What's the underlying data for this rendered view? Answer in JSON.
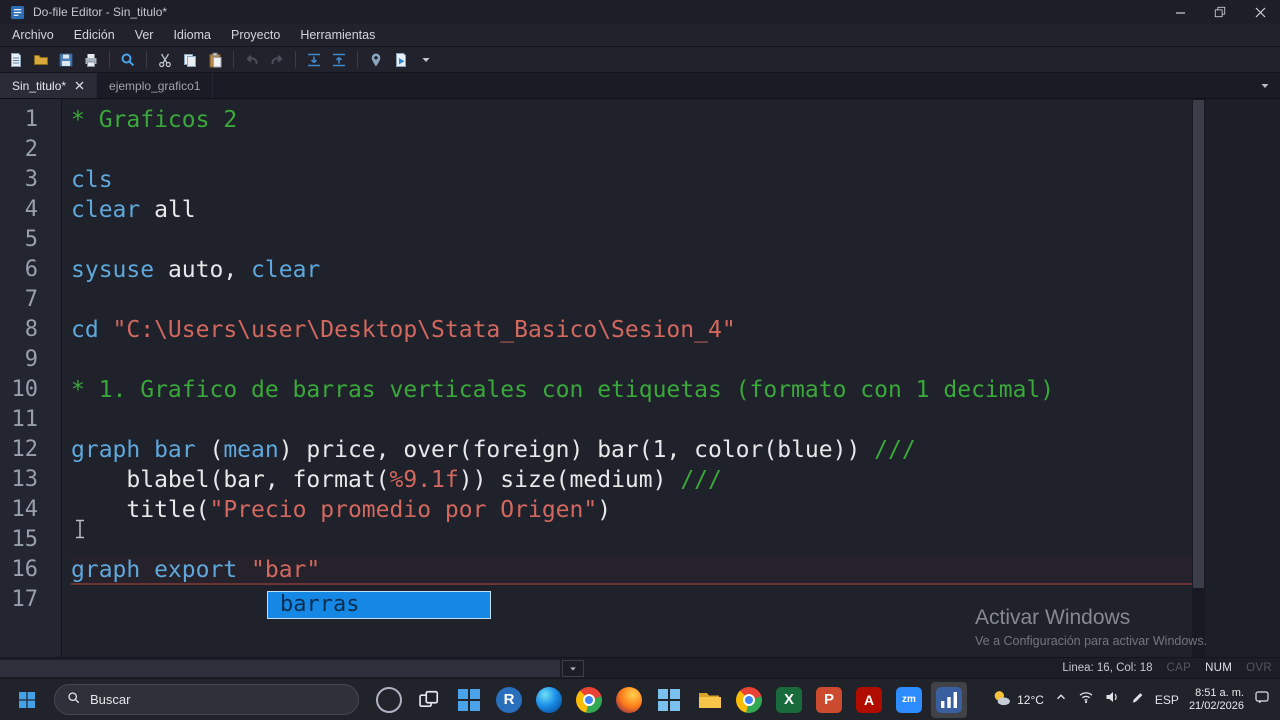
{
  "titlebar": {
    "title": "Do-file Editor - Sin_titulo*"
  },
  "menubar": {
    "items": [
      "Archivo",
      "Edición",
      "Ver",
      "Idioma",
      "Proyecto",
      "Herramientas"
    ]
  },
  "toolbar": {
    "buttons": [
      "new-do-file",
      "open-file",
      "save-file",
      "print",
      "find",
      "cut",
      "copy",
      "paste",
      "undo",
      "redo",
      "jump-next-line",
      "jump-prev-line",
      "set-marker",
      "execute-do",
      "execute-options"
    ]
  },
  "tabbar": {
    "tabs": [
      {
        "label": "Sin_titulo*",
        "active": true
      },
      {
        "label": "ejemplo_grafico1",
        "active": false
      }
    ]
  },
  "editor": {
    "current_line": 16,
    "lines": [
      {
        "n": "1",
        "segs": [
          [
            "* Graficos 2",
            "comment"
          ]
        ]
      },
      {
        "n": "2",
        "segs": []
      },
      {
        "n": "3",
        "segs": [
          [
            "cls",
            "cmd"
          ]
        ]
      },
      {
        "n": "4",
        "segs": [
          [
            "clear",
            "cmd"
          ],
          [
            " all",
            "plain"
          ]
        ]
      },
      {
        "n": "5",
        "segs": []
      },
      {
        "n": "6",
        "segs": [
          [
            "sysuse",
            "cmd"
          ],
          [
            " auto, ",
            "plain"
          ],
          [
            "clear",
            "cmd"
          ]
        ]
      },
      {
        "n": "7",
        "segs": []
      },
      {
        "n": "8",
        "segs": [
          [
            "cd ",
            "cmd"
          ],
          [
            "\"C:\\Users\\user\\Desktop\\Stata_Basico\\Sesion_4\"",
            "string"
          ]
        ]
      },
      {
        "n": "9",
        "segs": []
      },
      {
        "n": "10",
        "segs": [
          [
            "* 1. Grafico de barras verticales con etiquetas (formato con 1 decimal)",
            "comment"
          ]
        ]
      },
      {
        "n": "11",
        "segs": []
      },
      {
        "n": "12",
        "segs": [
          [
            "graph bar",
            "cmd"
          ],
          [
            " (",
            "plain"
          ],
          [
            "mean",
            "cmd"
          ],
          [
            ") price, over(foreign) bar(1, color(blue)) ",
            "plain"
          ],
          [
            "///",
            "comment"
          ]
        ]
      },
      {
        "n": "13",
        "segs": [
          [
            "    blabel(bar, format(",
            "plain"
          ],
          [
            "%9.1f",
            "string"
          ],
          [
            ")) size(medium) ",
            "plain"
          ],
          [
            "///",
            "comment"
          ]
        ]
      },
      {
        "n": "14",
        "segs": [
          [
            "    title(",
            "plain"
          ],
          [
            "\"Precio promedio por Origen\"",
            "string"
          ],
          [
            ")",
            "plain"
          ]
        ]
      },
      {
        "n": "15",
        "segs": []
      },
      {
        "n": "16",
        "segs": [
          [
            "graph export ",
            "cmd"
          ],
          [
            "\"bar\"",
            "string"
          ]
        ]
      },
      {
        "n": "17",
        "segs": []
      }
    ],
    "autocomplete": {
      "items": [
        {
          "label": "barras",
          "selected": true
        }
      ]
    }
  },
  "statusbar": {
    "position": "Linea: 16, Col: 18",
    "indicators": {
      "cap": "CAP",
      "num": "NUM",
      "ovr": "OVR"
    }
  },
  "watermark": {
    "line1": "Activar Windows",
    "line2": "Ve a Configuración para activar Windows."
  },
  "taskbar": {
    "search_label": "Buscar",
    "icons": [
      "start",
      "search",
      "copilot",
      "task-view",
      "apps-grid",
      "r-project",
      "edge",
      "chrome",
      "firefox",
      "apps-grid-2",
      "file-explorer",
      "chrome-2",
      "excel",
      "powerpoint",
      "acrobat",
      "zoom",
      "stata"
    ],
    "apps": {
      "r": "R",
      "excel": "X",
      "powerpoint": "P",
      "acrobat": "A",
      "zoom": "zm"
    },
    "tray": {
      "temperature": "12°C",
      "language": "ESP",
      "time": "8:51 a. m.",
      "date": "21/02/2026"
    }
  }
}
